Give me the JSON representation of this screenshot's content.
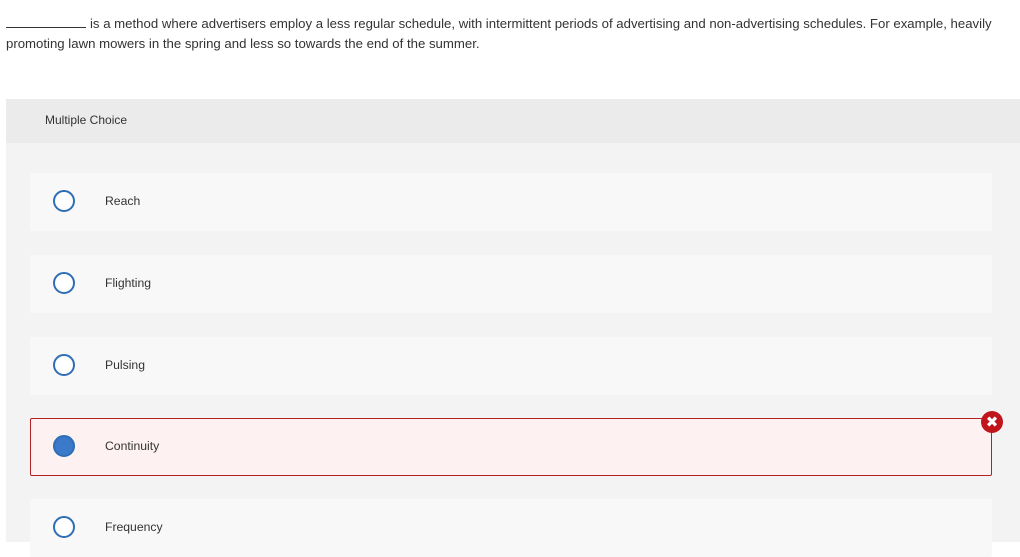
{
  "question": {
    "text": "is a method where advertisers employ a less regular schedule, with intermittent periods of advertising and non-advertising schedules. For example, heavily promoting lawn mowers in the spring and less so towards the end of the summer."
  },
  "panel": {
    "title": "Multiple Choice",
    "options": [
      {
        "label": "Reach",
        "selected": false
      },
      {
        "label": "Flighting",
        "selected": false
      },
      {
        "label": "Pulsing",
        "selected": false
      },
      {
        "label": "Continuity",
        "selected": true,
        "status": "incorrect"
      },
      {
        "label": "Frequency",
        "selected": false
      }
    ]
  },
  "icons": {
    "incorrect": "close-x-icon",
    "unselected": "radio-empty-icon",
    "selected": "radio-filled-icon"
  },
  "colors": {
    "radio_border": "#2f6db5",
    "radio_fill": "#3b7acb",
    "incorrect": "#c0151b",
    "incorrect_bg": "#fdf1f1"
  }
}
